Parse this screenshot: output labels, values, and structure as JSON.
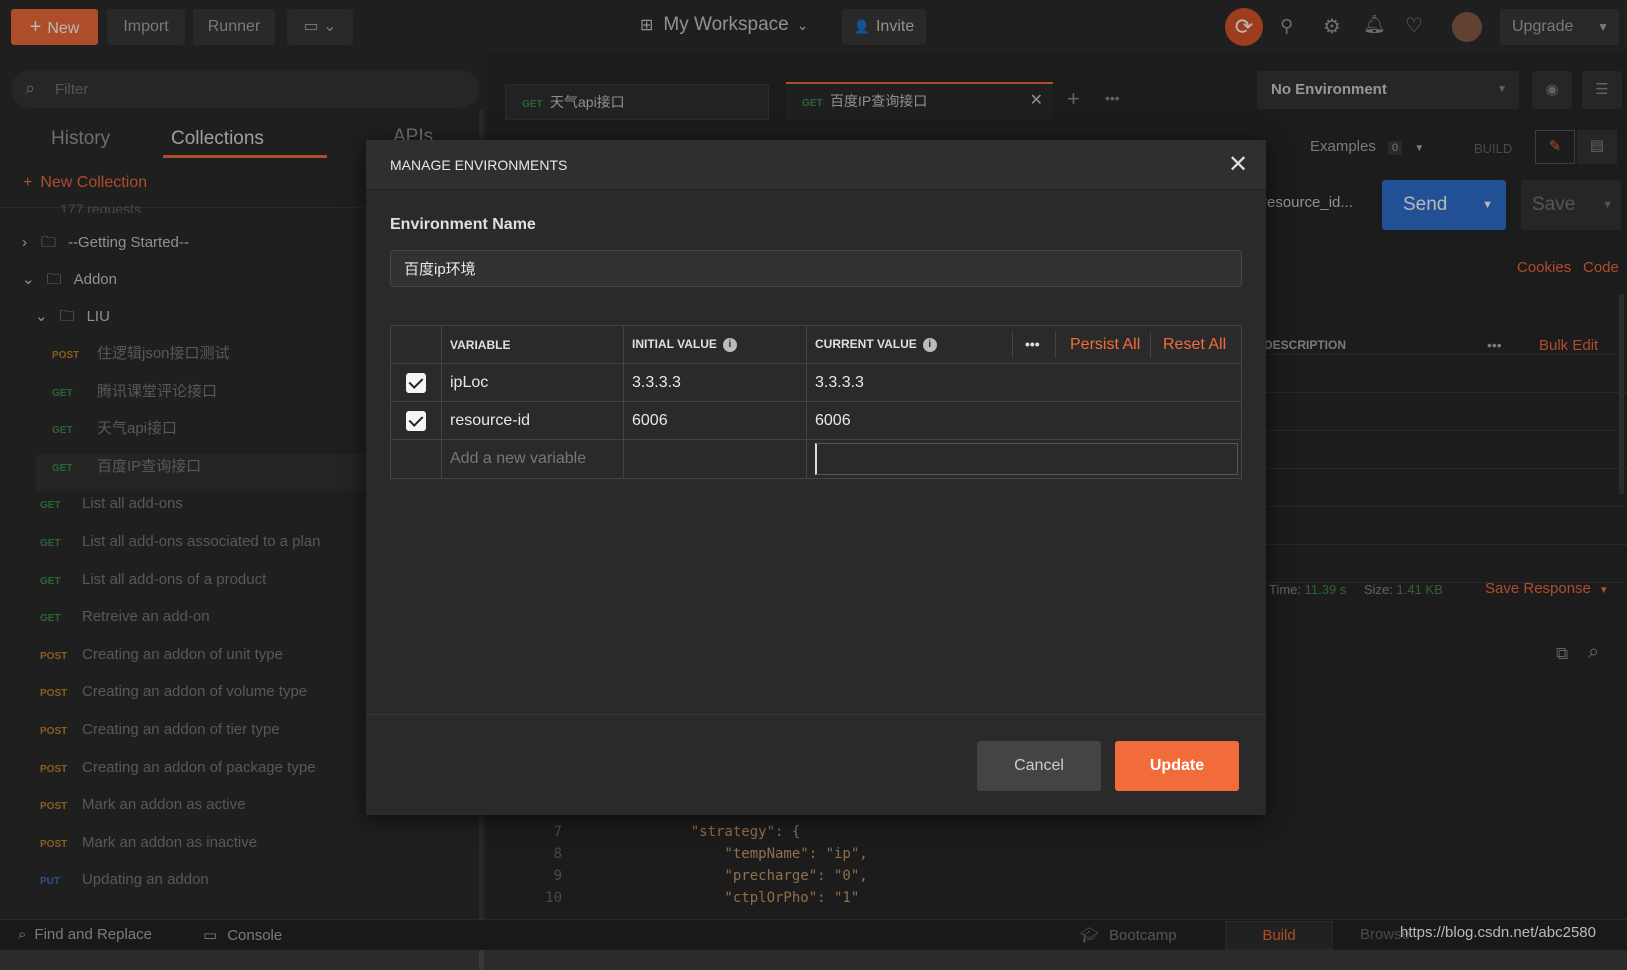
{
  "topbar": {
    "new": "New",
    "import": "Import",
    "runner": "Runner",
    "workspace": "My Workspace",
    "invite": "Invite",
    "upgrade": "Upgrade"
  },
  "search": {
    "placeholder": "Filter"
  },
  "sidebar": {
    "tabs": [
      "History",
      "Collections",
      "APIs"
    ],
    "new_collection": "New Collection",
    "requests_count": "177 requests",
    "folders": [
      "--Getting Started--",
      "Addon",
      "LIU"
    ],
    "items": [
      {
        "method": "POST",
        "label": "住逻辑json接口测试",
        "cls": "post",
        "indent": 1
      },
      {
        "method": "GET",
        "label": "腾讯课堂评论接口",
        "cls": "get",
        "indent": 1
      },
      {
        "method": "GET",
        "label": "天气api接口",
        "cls": "get",
        "indent": 1
      },
      {
        "method": "GET",
        "label": "百度IP查询接口",
        "cls": "get",
        "indent": 1
      },
      {
        "method": "GET",
        "label": "List all add-ons",
        "cls": "get",
        "indent": 0
      },
      {
        "method": "GET",
        "label": "List all add-ons associated to a plan",
        "cls": "get",
        "indent": 0
      },
      {
        "method": "GET",
        "label": "List all add-ons of a product",
        "cls": "get",
        "indent": 0
      },
      {
        "method": "GET",
        "label": "Retreive an add-on",
        "cls": "get",
        "indent": 0
      },
      {
        "method": "POST",
        "label": "Creating an addon of unit type",
        "cls": "post",
        "indent": 0
      },
      {
        "method": "POST",
        "label": "Creating an addon of volume type",
        "cls": "post",
        "indent": 0
      },
      {
        "method": "POST",
        "label": "Creating an addon of tier type",
        "cls": "post",
        "indent": 0
      },
      {
        "method": "POST",
        "label": "Creating an addon of package type",
        "cls": "post",
        "indent": 0
      },
      {
        "method": "POST",
        "label": "Mark an addon as active",
        "cls": "post",
        "indent": 0
      },
      {
        "method": "POST",
        "label": "Mark an addon as inactive",
        "cls": "post",
        "indent": 0
      },
      {
        "method": "PUT",
        "label": "Updating an addon",
        "cls": "put",
        "indent": 0
      }
    ]
  },
  "tabs": [
    {
      "method": "GET",
      "label": "天气api接口"
    },
    {
      "method": "GET",
      "label": "百度IP查询接口"
    }
  ],
  "environment": {
    "selected": "No Environment"
  },
  "request": {
    "examples": "Examples",
    "examples_count": "0",
    "build": "BUILD",
    "url_tail": "resource_id...",
    "send": "Send",
    "save": "Save",
    "cookies": "Cookies",
    "code": "Code",
    "description": "DESCRIPTION",
    "bulk_edit": "Bulk Edit"
  },
  "response": {
    "time_label": "Time:",
    "time": "11.39 s",
    "size_label": "Size:",
    "size": "1.41 KB",
    "save_response": "Save Response"
  },
  "code_lines": [
    {
      "n": "7",
      "text": "    \"strategy\": {"
    },
    {
      "n": "8",
      "text": "        \"tempName\": \"ip\","
    },
    {
      "n": "9",
      "text": "        \"precharge\": \"0\","
    },
    {
      "n": "10",
      "text": "        \"ctplOrPho\": \"1\""
    }
  ],
  "modal": {
    "title": "MANAGE ENVIRONMENTS",
    "env_name_label": "Environment Name",
    "env_name": "百度ip环境",
    "headers": {
      "variable": "VARIABLE",
      "initial": "INITIAL VALUE",
      "current": "CURRENT VALUE",
      "persist_all": "Persist All",
      "reset_all": "Reset All"
    },
    "rows": [
      {
        "variable": "ipLoc",
        "initial": "3.3.3.3",
        "current": "3.3.3.3"
      },
      {
        "variable": "resource-id",
        "initial": "6006",
        "current": "6006"
      }
    ],
    "new_var_placeholder": "Add a new variable",
    "cancel": "Cancel",
    "update": "Update"
  },
  "footer": {
    "find_replace": "Find and Replace",
    "console": "Console",
    "bootcamp": "Bootcamp",
    "build": "Build",
    "browse": "Browse",
    "watermark": "https://blog.csdn.net/abc2580"
  },
  "colors": {
    "accent": "#f26b3a",
    "send": "#2f6fcf"
  }
}
